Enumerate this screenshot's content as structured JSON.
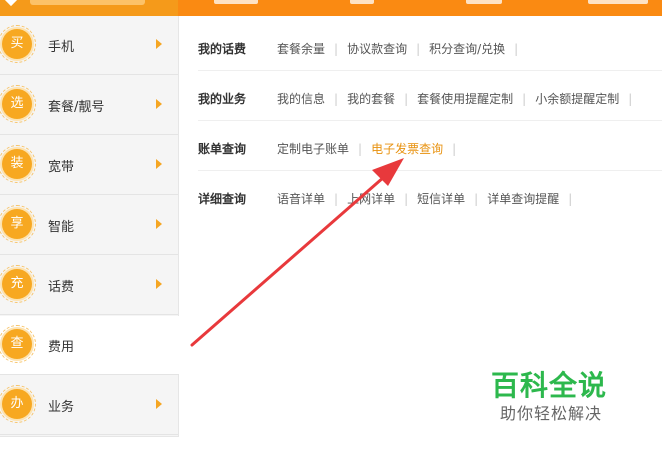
{
  "sidebar": {
    "items": [
      {
        "badge": "买",
        "label": "手机",
        "has_chevron": true
      },
      {
        "badge": "选",
        "label": "套餐/靓号",
        "has_chevron": true
      },
      {
        "badge": "装",
        "label": "宽带",
        "has_chevron": true
      },
      {
        "badge": "享",
        "label": "智能",
        "has_chevron": true
      },
      {
        "badge": "充",
        "label": "话费",
        "has_chevron": true
      },
      {
        "badge": "查",
        "label": "费用",
        "has_chevron": false
      },
      {
        "badge": "办",
        "label": "业务",
        "has_chevron": true
      }
    ]
  },
  "panel": {
    "rows": [
      {
        "title": "我的话费",
        "links": [
          "套餐余量",
          "协议款查询",
          "积分查询/兑换"
        ]
      },
      {
        "title": "我的业务",
        "links": [
          "我的信息",
          "我的套餐",
          "套餐使用提醒定制",
          "小余额提醒定制"
        ]
      },
      {
        "title": "账单查询",
        "links": [
          "定制电子账单",
          "电子发票查询"
        ]
      },
      {
        "title": "详细查询",
        "links": [
          "语音详单",
          "上网详单",
          "短信详单",
          "详单查询提醒"
        ]
      }
    ],
    "highlighted_link": "电子发票查询"
  },
  "watermark": {
    "title": "百科全说",
    "subtitle": "助你轻松解决"
  },
  "colors": {
    "topbar": "#fa8a12",
    "badge": "#f7a821",
    "highlight_link": "#e8920f",
    "annotation_arrow": "#e8393c",
    "watermark_green": "#2db84d"
  },
  "icons": {
    "side_chevron": "chevron-right-icon",
    "annotation": "red-arrow-annotation"
  }
}
